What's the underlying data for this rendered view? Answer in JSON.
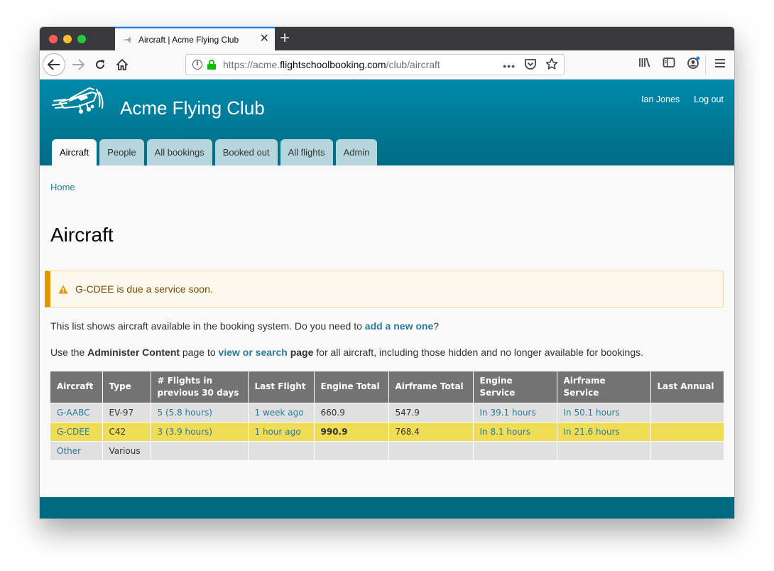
{
  "browser": {
    "tab_title": "Aircraft | Acme Flying Club",
    "url_scheme_prefix": "https://acme.",
    "url_host": "flightschoolbooking.com",
    "url_path": "/club/aircraft",
    "icons": {
      "back": "arrow-left-icon",
      "forward": "arrow-right-icon",
      "reload": "reload-icon",
      "home": "home-icon",
      "info": "info-icon",
      "lock": "lock-icon",
      "page_actions": "more-dots-icon",
      "pocket": "pocket-icon",
      "bookmark": "star-icon",
      "library": "library-icon",
      "sidebar": "sidebar-icon",
      "account": "account-icon",
      "menu": "hamburger-menu-icon"
    },
    "glyphs": {
      "close": "✕",
      "new_tab": "+",
      "back": "←",
      "forward": "→",
      "reload": "↻",
      "info": "i",
      "dots": "•••"
    }
  },
  "site": {
    "name": "Acme Flying Club",
    "user_name": "Ian Jones",
    "logout_label": "Log out",
    "nav_tabs": [
      {
        "label": "Aircraft",
        "active": true
      },
      {
        "label": "People",
        "active": false
      },
      {
        "label": "All bookings",
        "active": false
      },
      {
        "label": "Booked out",
        "active": false
      },
      {
        "label": "All flights",
        "active": false
      },
      {
        "label": "Admin",
        "active": false
      }
    ],
    "colors": {
      "header_top": "#008aaa",
      "header_bottom": "#006b85",
      "link": "#2b7a9b",
      "alert_accent": "#e09600",
      "highlight_row": "#efdd57",
      "table_header": "#737373"
    }
  },
  "page": {
    "breadcrumb": "Home",
    "title": "Aircraft",
    "alert": {
      "icon": "warning-icon",
      "message": "G-CDEE is due a service soon."
    },
    "intro1": {
      "text_before": "This list shows aircraft available in the booking system. Do you need to ",
      "link": "add a new one",
      "text_after": "?"
    },
    "intro2": {
      "text_before": "Use the ",
      "bold1": "Administer Content",
      "text_mid": " page to ",
      "link": "view or search",
      "bold2": " page",
      "text_after": " for all aircraft, including those hidden and no longer available for bookings."
    }
  },
  "table": {
    "headers": [
      "Aircraft",
      "Type",
      "# Flights in previous 30 days",
      "Last Flight",
      "Engine Total",
      "Airframe Total",
      "Engine Service",
      "Airframe Service",
      "Last Annual"
    ],
    "rows": [
      {
        "aircraft": "G-AABC",
        "type": "EV-97",
        "flights": "5 (5.8 hours)",
        "last_flight": "1 week ago",
        "engine_total": "660.9",
        "airframe_total": "547.9",
        "engine_service": "In 39.1 hours",
        "airframe_service": "In 50.1 hours",
        "last_annual": "",
        "highlight": false
      },
      {
        "aircraft": "G-CDEE",
        "type": "C42",
        "flights": "3 (3.9 hours)",
        "last_flight": "1 hour ago",
        "engine_total": "990.9",
        "airframe_total": "768.4",
        "engine_service": "In 8.1 hours",
        "airframe_service": "In 21.6 hours",
        "last_annual": "",
        "highlight": true
      },
      {
        "aircraft": "Other",
        "type": "Various",
        "flights": "",
        "last_flight": "",
        "engine_total": "",
        "airframe_total": "",
        "engine_service": "",
        "airframe_service": "",
        "last_annual": "",
        "highlight": false
      }
    ]
  }
}
